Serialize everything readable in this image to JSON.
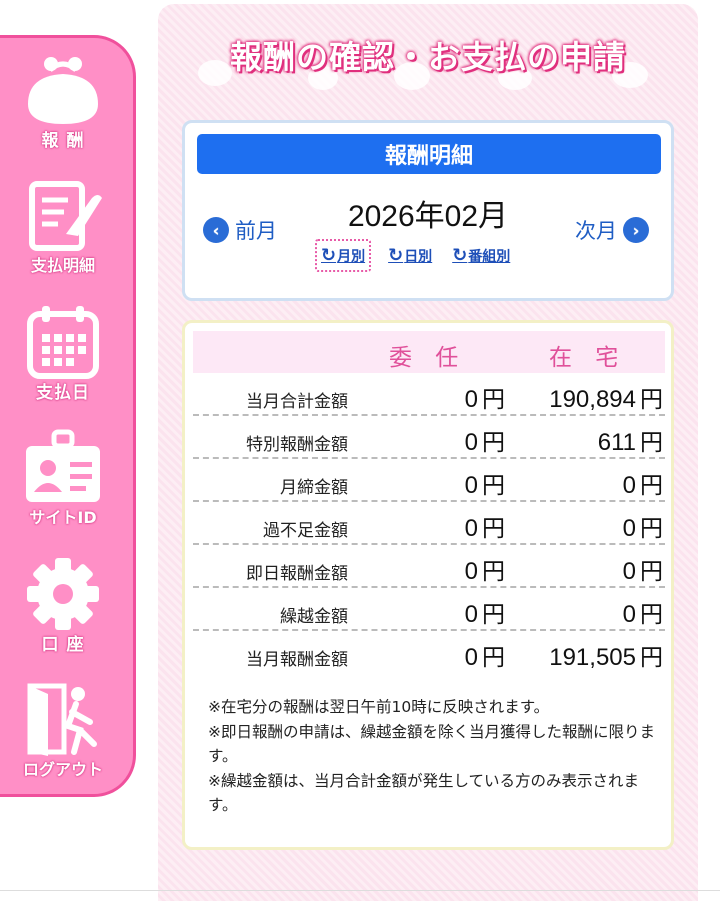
{
  "sidebar": {
    "items": [
      {
        "label": "報 酬",
        "icon": "purse-icon"
      },
      {
        "label": "支払明細",
        "icon": "document-pen-icon"
      },
      {
        "label": "支払日",
        "icon": "calendar-icon"
      },
      {
        "label": "サイトID",
        "icon": "id-card-icon"
      },
      {
        "label": "口 座",
        "icon": "gear-icon"
      },
      {
        "label": "ログアウト",
        "icon": "exit-door-icon"
      }
    ]
  },
  "page": {
    "title": "報酬の確認・お支払の申請"
  },
  "statement": {
    "header": "報酬明細",
    "month": "2026年02月",
    "prev_label": "前月",
    "next_label": "次月",
    "views": [
      {
        "label": "月別",
        "active": true
      },
      {
        "label": "日別",
        "active": false
      },
      {
        "label": "番組別",
        "active": false
      }
    ]
  },
  "table": {
    "columns": [
      "委 任",
      "在 宅"
    ],
    "currency": "円",
    "rows": [
      {
        "label": "当月合計金額",
        "a": "0",
        "b": "190,894"
      },
      {
        "label": "特別報酬金額",
        "a": "0",
        "b": "611"
      },
      {
        "label": "月締金額",
        "a": "0",
        "b": "0"
      },
      {
        "label": "過不足金額",
        "a": "0",
        "b": "0"
      },
      {
        "label": "即日報酬金額",
        "a": "0",
        "b": "0"
      },
      {
        "label": "繰越金額",
        "a": "0",
        "b": "0"
      },
      {
        "label": "当月報酬金額",
        "a": "0",
        "b": "191,505"
      }
    ]
  },
  "notes": [
    "※在宅分の報酬は翌日午前10時に反映されます。",
    "※即日報酬の申請は、繰越金額を除く当月獲得した報酬に限ります。",
    "※繰越金額は、当月合計金額が発生している方のみ表示されます。"
  ],
  "colors": {
    "accent_pink": "#ff8fc6",
    "header_blue": "#1e6ff0",
    "title_pink": "#e0307e"
  }
}
